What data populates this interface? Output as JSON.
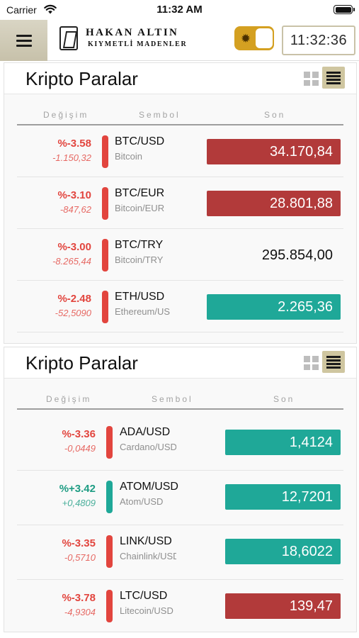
{
  "status_bar": {
    "carrier": "Carrier",
    "time": "11:32 AM"
  },
  "header": {
    "brand": "HAKAN ALTIN",
    "brand_sub": "KIYMETLİ MADENLER",
    "clock": "11:32:36"
  },
  "colors": {
    "down": "#b23a3a",
    "up": "#1fa898",
    "down_text": "#e2453e",
    "up_text": "#1d9c83",
    "accent": "#d4a021"
  },
  "panels": [
    {
      "title": "Kripto Paralar",
      "columns": {
        "change": "Değişim",
        "symbol": "Sembol",
        "last": "Son"
      },
      "rows": [
        {
          "change": "%-3.58",
          "change_abs": "-1.150,32",
          "symbol": "BTC/USD",
          "name": "Bitcoin",
          "price": "34.170,84",
          "direction": "down",
          "price_style": "down"
        },
        {
          "change": "%-3.10",
          "change_abs": "-847,62",
          "symbol": "BTC/EUR",
          "name": "Bitcoin/EUR",
          "price": "28.801,88",
          "direction": "down",
          "price_style": "down"
        },
        {
          "change": "%-3.00",
          "change_abs": "-8.265,44",
          "symbol": "BTC/TRY",
          "name": "Bitcoin/TRY",
          "price": "295.854,00",
          "direction": "down",
          "price_style": "plain"
        },
        {
          "change": "%-2.48",
          "change_abs": "-52,5090",
          "symbol": "ETH/USD",
          "name": "Ethereum/USD",
          "price": "2.265,36",
          "direction": "down",
          "price_style": "up"
        }
      ]
    },
    {
      "title": "Kripto Paralar",
      "columns": {
        "change": "Değişim",
        "symbol": "Sembol",
        "last": "Son"
      },
      "rows": [
        {
          "change": "%-3.36",
          "change_abs": "-0,0449",
          "symbol": "ADA/USD",
          "name": "Cardano/USD",
          "price": "1,4124",
          "direction": "down",
          "price_style": "up"
        },
        {
          "change": "%+3.42",
          "change_abs": "+0,4809",
          "symbol": "ATOM/USD",
          "name": "Atom/USD",
          "price": "12,7201",
          "direction": "up",
          "price_style": "up"
        },
        {
          "change": "%-3.35",
          "change_abs": "-0,5710",
          "symbol": "LINK/USD",
          "name": "Chainlink/USD",
          "price": "18,6022",
          "direction": "down",
          "price_style": "up"
        },
        {
          "change": "%-3.78",
          "change_abs": "-4,9304",
          "symbol": "LTC/USD",
          "name": "Litecoin/USD",
          "price": "139,47",
          "direction": "down",
          "price_style": "down"
        }
      ]
    }
  ]
}
